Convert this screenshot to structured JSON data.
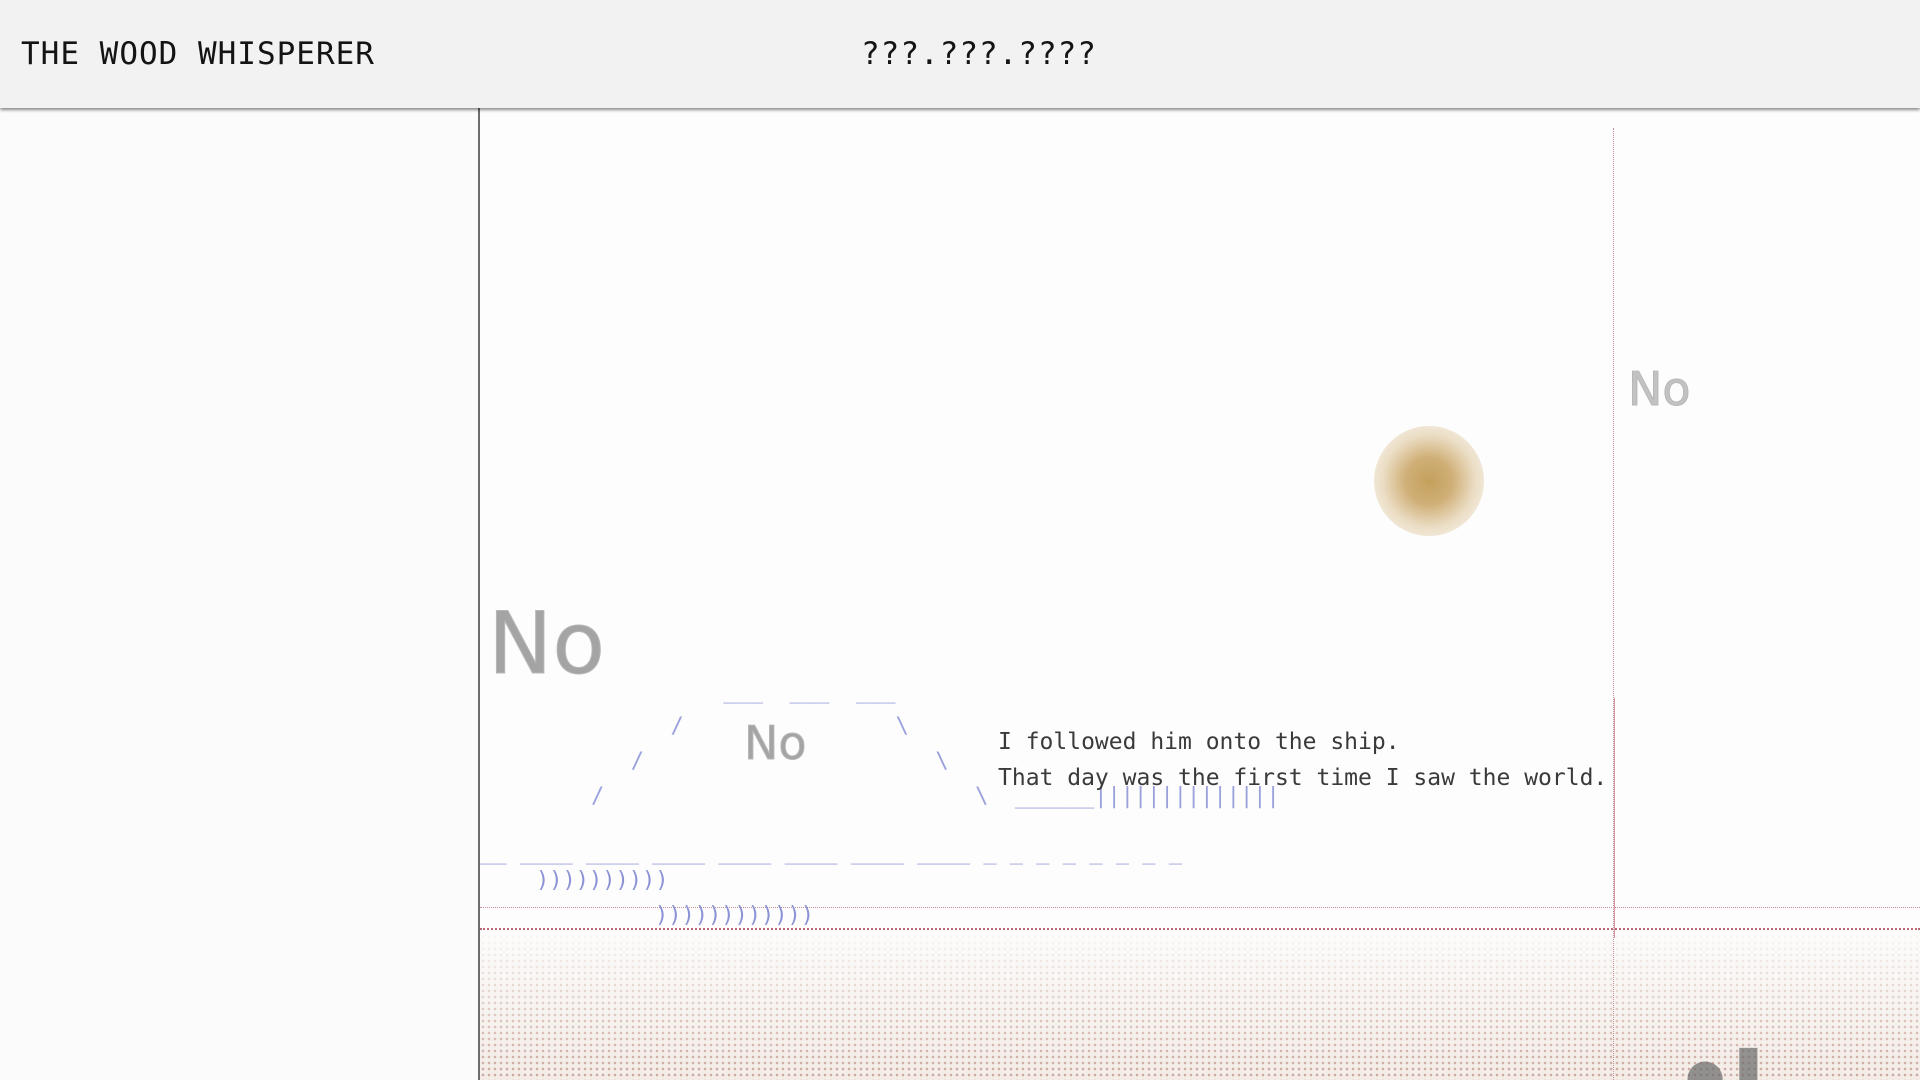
{
  "header": {
    "brand": "THE WOOD WHISPERER",
    "phone": "???.???.????"
  },
  "scene": {
    "labels": {
      "no_large": "No",
      "no_right": "No",
      "no_ship": "No"
    },
    "story": {
      "line1": "I followed him onto the ship.",
      "line2": "That day was the first time I saw the world."
    },
    "ascii": {
      "ship": "              ___  ___  ___\n          /                \\\n       /                      \\\n    /                            \\  ______||||||||||||||",
      "deck": "__ ____ ____ ____ ____ ____ ____ ____ _ _ _ _ _ _ _ _",
      "waves1": "))))))))))",
      "waves2": "))))))))))))"
    },
    "colors": {
      "ascii": "#8a93d6",
      "sun": "#c4a05c",
      "guide_lines": "#c88f98",
      "ground": "#aa6e5a"
    }
  }
}
